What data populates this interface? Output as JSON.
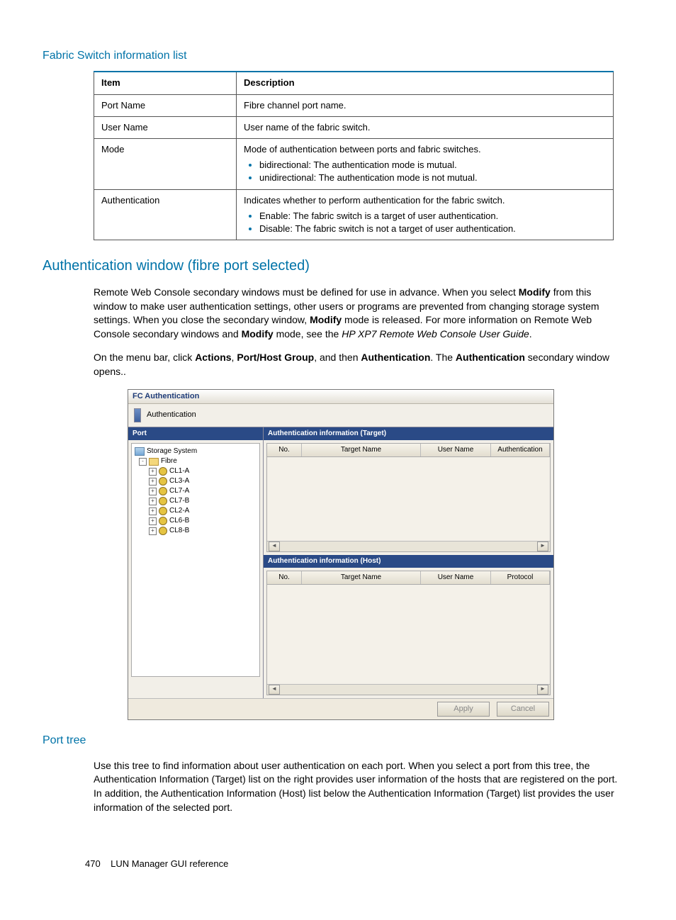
{
  "section1": {
    "title": "Fabric Switch information list",
    "table": {
      "head_item": "Item",
      "head_desc": "Description",
      "rows": [
        {
          "item": "Port Name",
          "desc": "Fibre channel port name."
        },
        {
          "item": "User Name",
          "desc": "User name of the fabric switch."
        },
        {
          "item": "Mode",
          "desc": "Mode of authentication between ports and fabric switches.",
          "bullets": [
            "bidirectional: The authentication mode is mutual.",
            "unidirectional: The authentication mode is not mutual."
          ]
        },
        {
          "item": "Authentication",
          "desc": "Indicates whether to perform authentication for the fabric switch.",
          "bullets": [
            "Enable: The fabric switch is a target of user authentication.",
            "Disable: The fabric switch is not a target of user authentication."
          ]
        }
      ]
    }
  },
  "section2": {
    "title": "Authentication window (fibre port selected)",
    "para1_a": "Remote Web Console secondary windows must be defined for use in advance. When you select ",
    "para1_b": "Modify",
    "para1_c": " from this window to make user authentication settings, other users or programs are prevented from changing storage system settings. When you close the secondary window, ",
    "para1_d": "Modify",
    "para1_e": " mode is released. For more information on Remote Web Console secondary windows and ",
    "para1_f": "Modify",
    "para1_g": " mode, see the ",
    "para1_h": "HP XP7 Remote Web Console User Guide",
    "para1_i": ".",
    "para2_a": "On the menu bar, click ",
    "para2_b": "Actions",
    "para2_c": ", ",
    "para2_d": "Port/Host Group",
    "para2_e": ", and then ",
    "para2_f": "Authentication",
    "para2_g": ". The ",
    "para2_h": "Authentication",
    "para2_i": " secondary window opens.."
  },
  "screenshot": {
    "titlebar": "FC Authentication",
    "tab": "Authentication",
    "port_head": "Port",
    "auth_target_head": "Authentication information (Target)",
    "auth_host_head": "Authentication information (Host)",
    "tree": {
      "root": "Storage System",
      "fibre": "Fibre",
      "ports": [
        "CL1-A",
        "CL3-A",
        "CL7-A",
        "CL7-B",
        "CL2-A",
        "CL6-B",
        "CL8-B"
      ]
    },
    "target_cols": {
      "no": "No.",
      "target": "Target Name",
      "user": "User Name",
      "auth": "Authentication"
    },
    "host_cols": {
      "no": "No.",
      "target": "Target Name",
      "user": "User Name",
      "proto": "Protocol"
    },
    "apply": "Apply",
    "cancel": "Cancel"
  },
  "section3": {
    "title": "Port tree",
    "para": "Use this tree to find information about user authentication on each port. When you select a port from this tree, the Authentication Information (Target) list on the right provides user information of the hosts that are registered on the port. In addition, the Authentication Information (Host) list below the Authentication Information (Target) list provides the user information of the selected port."
  },
  "footer": {
    "page": "470",
    "title": "LUN Manager GUI reference"
  }
}
